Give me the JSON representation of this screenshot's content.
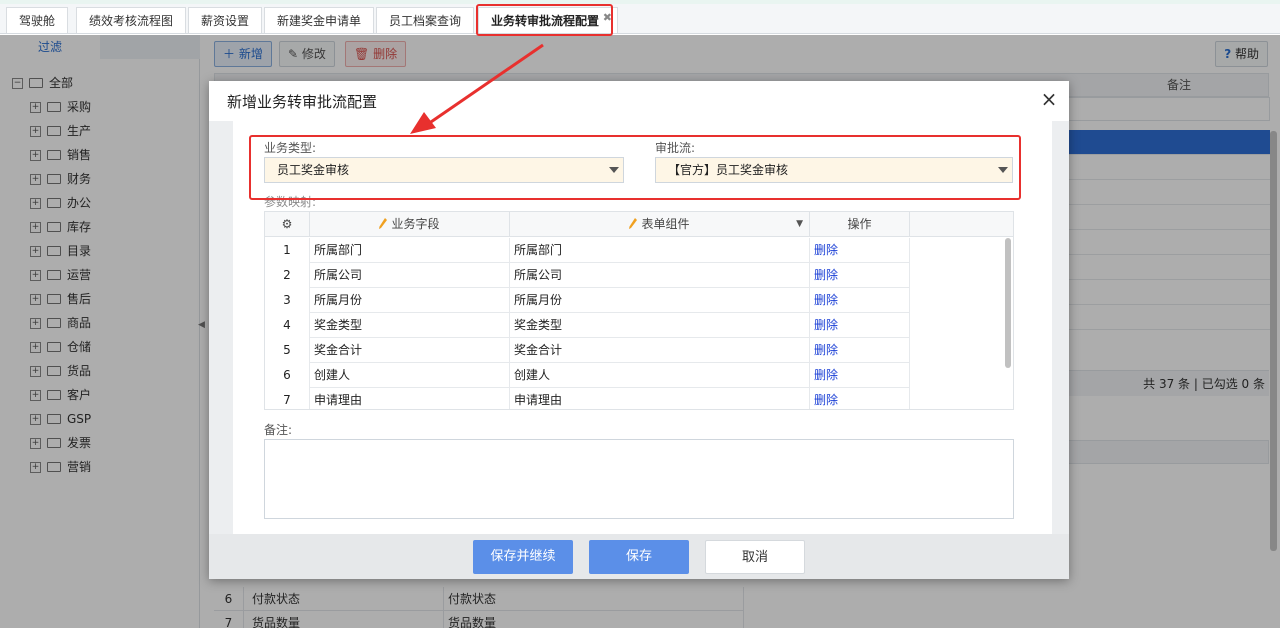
{
  "tabs": [
    {
      "label": "驾驶舱"
    },
    {
      "label": "绩效考核流程图"
    },
    {
      "label": "薪资设置"
    },
    {
      "label": "新建奖金申请单"
    },
    {
      "label": "员工档案查询"
    },
    {
      "label": "业务转审批流程配置",
      "active": true
    }
  ],
  "left_panel": {
    "filter_label": "过滤",
    "tree": [
      {
        "label": "全部",
        "root": true
      },
      {
        "label": "采购"
      },
      {
        "label": "生产"
      },
      {
        "label": "销售"
      },
      {
        "label": "财务"
      },
      {
        "label": "办公"
      },
      {
        "label": "库存"
      },
      {
        "label": "目录"
      },
      {
        "label": "运营"
      },
      {
        "label": "售后"
      },
      {
        "label": "商品"
      },
      {
        "label": "仓储"
      },
      {
        "label": "货品"
      },
      {
        "label": "客户"
      },
      {
        "label": "GSP"
      },
      {
        "label": "发票"
      },
      {
        "label": "营销"
      }
    ]
  },
  "toolbar": {
    "new_label": "新增",
    "edit_label": "修改",
    "delete_label": "删除",
    "help_label": "帮助"
  },
  "grid": {
    "note_col": "备注",
    "pager_text": "共 37 条 | 已勾选 0 条"
  },
  "background_rows": [
    {
      "n": "6",
      "a": "付款状态",
      "b": "付款状态"
    },
    {
      "n": "7",
      "a": "货品数量",
      "b": "货品数量"
    }
  ],
  "modal": {
    "title": "新增业务转审批流配置",
    "close_glyph": "×",
    "business_type_label": "业务类型:",
    "business_type_value": "员工奖金审核",
    "approval_flow_label": "审批流:",
    "approval_flow_value": "【官方】员工奖金审核",
    "param_mapping_label": "参数映射:",
    "table_headers": {
      "field": "业务字段",
      "component": "表单组件",
      "action": "操作"
    },
    "rows": [
      {
        "n": "1",
        "field": "所属部门",
        "component": "所属部门",
        "action": "删除"
      },
      {
        "n": "2",
        "field": "所属公司",
        "component": "所属公司",
        "action": "删除"
      },
      {
        "n": "3",
        "field": "所属月份",
        "component": "所属月份",
        "action": "删除"
      },
      {
        "n": "4",
        "field": "奖金类型",
        "component": "奖金类型",
        "action": "删除"
      },
      {
        "n": "5",
        "field": "奖金合计",
        "component": "奖金合计",
        "action": "删除"
      },
      {
        "n": "6",
        "field": "创建人",
        "component": "创建人",
        "action": "删除"
      },
      {
        "n": "7",
        "field": "申请理由",
        "component": "申请理由",
        "action": "删除"
      }
    ],
    "remark_label": "备注:",
    "buttons": {
      "save_continue": "保存并继续",
      "save": "保存",
      "cancel": "取消"
    }
  },
  "colors": {
    "primary": "#5b8fe8",
    "highlight": "#e8302e",
    "link": "#1a3fd6",
    "select_bg": "#fef6e6"
  }
}
